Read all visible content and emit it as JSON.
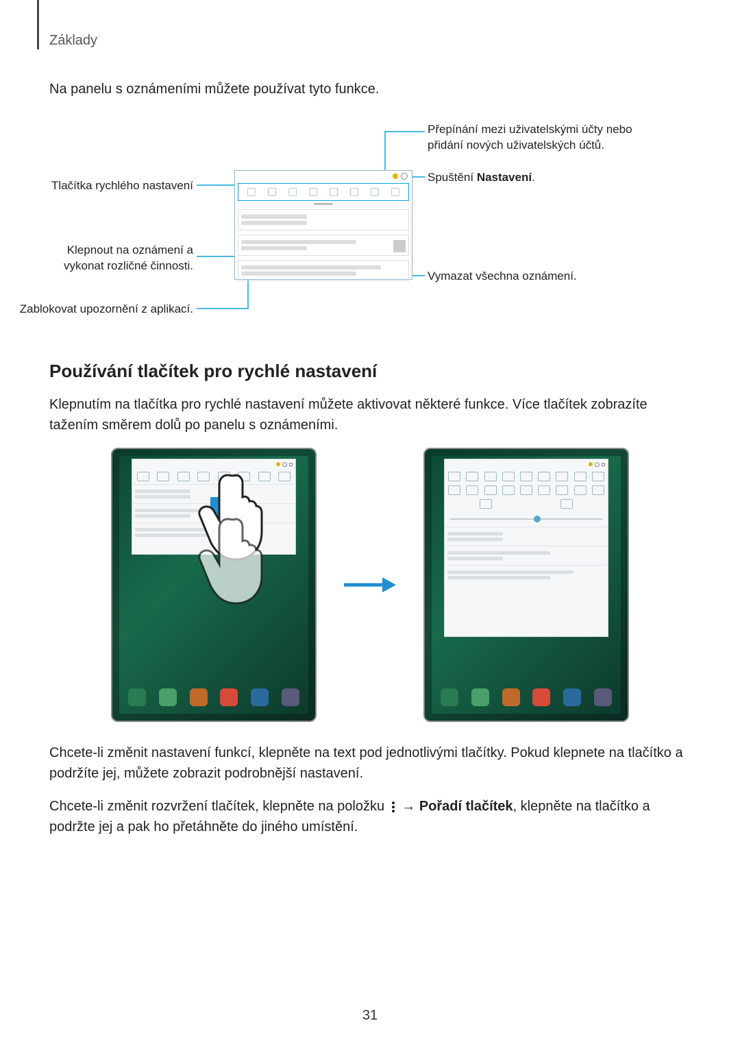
{
  "header": {
    "section_label": "Základy"
  },
  "intro": "Na panelu s oznámeními můžete používat tyto funkce.",
  "diagram": {
    "left": {
      "quick_settings": "Tlačítka rychlého nastavení",
      "tap_notification": "Klepnout na oznámení a vykonat rozličné činnosti.",
      "block_app": "Zablokovat upozornění z aplikací."
    },
    "right": {
      "switch_users": "Přepínání mezi uživatelskými účty nebo přidání nových uživatelských účtů.",
      "launch_settings_pre": "Spuštění ",
      "launch_settings_bold": "Nastavení",
      "launch_settings_post": ".",
      "clear_all": "Vymazat všechna oznámení."
    }
  },
  "section2": {
    "heading": "Používání tlačítek pro rychlé nastavení",
    "para1": "Klepnutím na tlačítka pro rychlé nastavení můžete aktivovat některé funkce. Více tlačítek zobrazíte tažením směrem dolů po panelu s oznámeními.",
    "para2": "Chcete-li změnit nastavení funkcí, klepněte na text pod jednotlivými tlačítky. Pokud klepnete na tlačítko a podržíte jej, můžete zobrazit podrobnější nastavení.",
    "para3_pre": "Chcete-li změnit rozvržení tlačítek, klepněte na položku ",
    "para3_arrow": " → ",
    "para3_bold": "Pořadí tlačítek",
    "para3_post": ", klepněte na tlačítko a podržte jej a pak ho přetáhněte do jiného umístění."
  },
  "page_number": "31"
}
